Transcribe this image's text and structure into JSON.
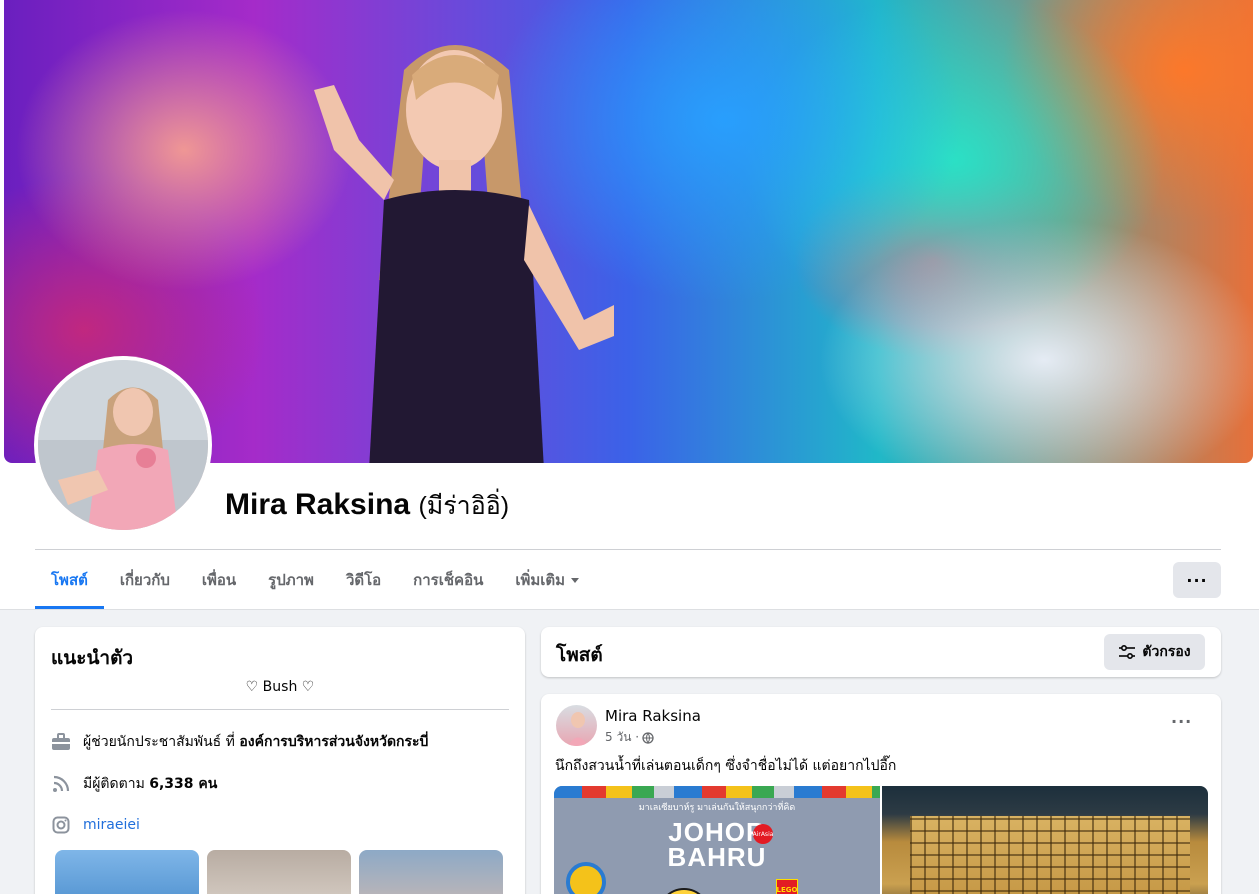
{
  "profile": {
    "name": "Mira Raksina",
    "alt_name": "(มีร่าอิอิ่)"
  },
  "tabs": [
    {
      "label": "โพสต์",
      "active": true
    },
    {
      "label": "เกี่ยวกับ",
      "active": false
    },
    {
      "label": "เพื่อน",
      "active": false
    },
    {
      "label": "รูปภาพ",
      "active": false
    },
    {
      "label": "วิดีโอ",
      "active": false
    },
    {
      "label": "การเช็คอิน",
      "active": false
    },
    {
      "label": "เพิ่มเติม",
      "active": false
    }
  ],
  "more_button_label": "···",
  "intro": {
    "title": "แนะนำตัว",
    "bio": "♡ Bush ♡",
    "work_prefix": "ผู้ช่วยนักประชาสัมพันธ์ ที่",
    "work_org": "องค์การบริหารส่วนจังหวัดกระบี่",
    "followers_prefix": "มีผู้ติดตาม",
    "followers_count": "6,338 คน",
    "instagram": "miraeiei"
  },
  "posts_section": {
    "title": "โพสต์",
    "filter_label": "ตัวกรอง"
  },
  "post": {
    "author": "Mira Raksina",
    "time": "5 วัน ·",
    "privacy_icon": "globe-icon",
    "text": "นึกถึงสวนน้ำที่เล่นตอนเด็กๆ ซึ่งจำชื่อไม่ได้ แต่อยากไปอี๊ก",
    "options_label": "···",
    "image_left": {
      "subtitle": "มาเลเซียบาห์รู มาเล่นกันให้สนุกกว่าที่คิด",
      "title_line1": "JOHOR",
      "title_line2": "BAHRU",
      "airline_badge": "AirAsia",
      "brand_badge": "LEGO"
    }
  },
  "colors": {
    "accent": "#1877f2",
    "background": "#f0f2f5",
    "card": "#ffffff",
    "secondary_text": "#65676b",
    "link": "#216fdb"
  }
}
